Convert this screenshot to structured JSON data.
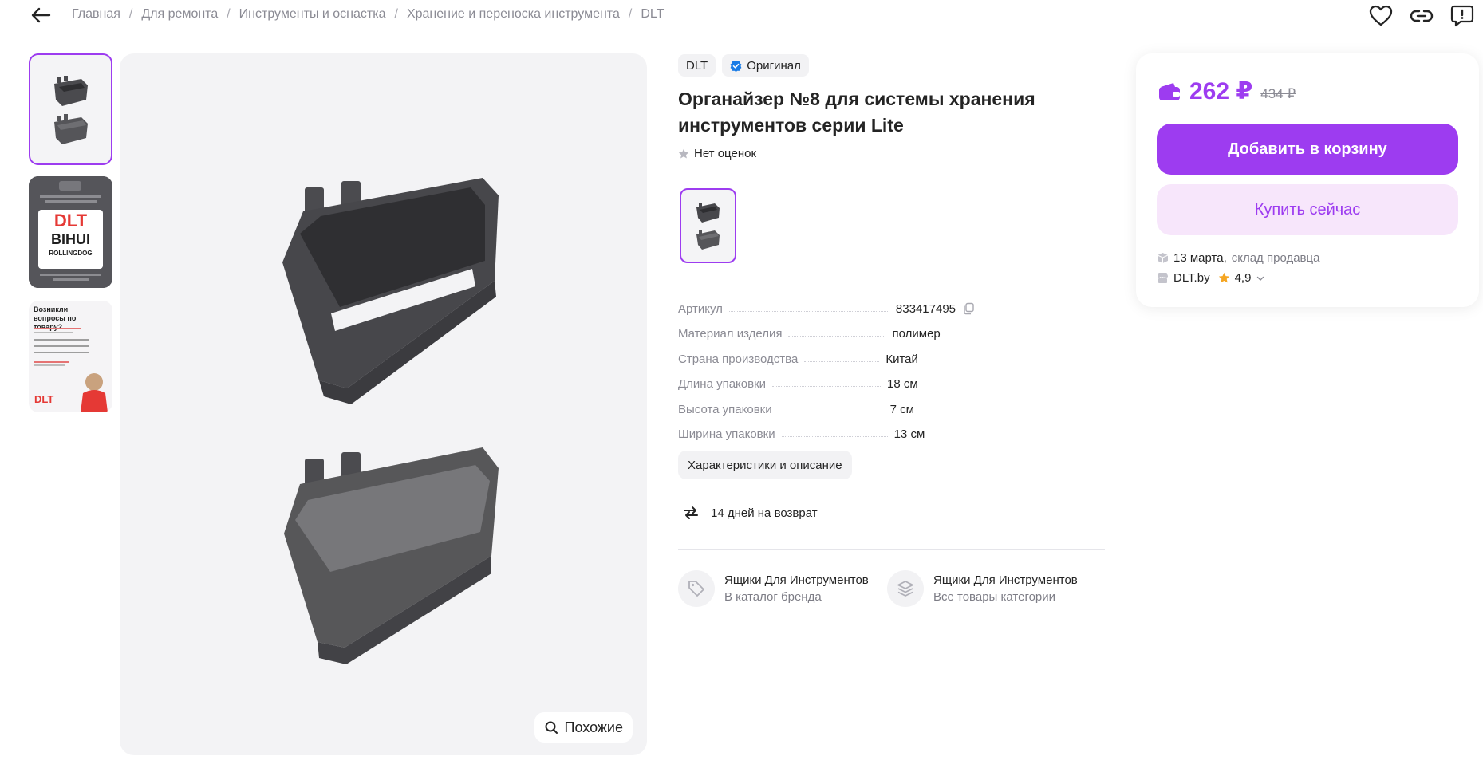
{
  "breadcrumb": {
    "items": [
      "Главная",
      "Для ремонта",
      "Инструменты и оснастка",
      "Хранение и переноска инструмента",
      "DLT"
    ],
    "separator": "/"
  },
  "top_actions": {
    "back_icon": "arrow-left-icon",
    "favorite_icon": "heart-icon",
    "share_icon": "link-icon",
    "report_icon": "report-icon"
  },
  "gallery": {
    "similar_label": "Похожие",
    "thumb2": {
      "line1": "DLT",
      "line2": "BIHUI",
      "line3": "ROLLINGDOG"
    },
    "thumb3": {
      "heading": "Возникли вопросы по товару?",
      "brand": "DLT"
    }
  },
  "product": {
    "brand_chip": "DLT",
    "original_chip": "Оригинал",
    "title": "Органайзер №8 для системы хранения инструментов серии Lite",
    "rating_text": "Нет оценок",
    "specs": [
      {
        "key": "Артикул",
        "value": "833417495"
      },
      {
        "key": "Материал изделия",
        "value": "полимер"
      },
      {
        "key": "Страна производства",
        "value": "Китай"
      },
      {
        "key": "Длина упаковки",
        "value": "18 см"
      },
      {
        "key": "Высота упаковки",
        "value": "7 см"
      },
      {
        "key": "Ширина упаковки",
        "value": "13 см"
      }
    ],
    "description_button": "Характеристики и описание",
    "return_text": "14 дней на возврат",
    "catalog_links": [
      {
        "title": "Ящики Для Инструментов",
        "subtitle": "В каталог бренда",
        "icon": "tag-icon"
      },
      {
        "title": "Ящики Для Инструментов",
        "subtitle": "Все товары категории",
        "icon": "layers-icon"
      }
    ]
  },
  "buy_box": {
    "price": "262 ₽",
    "old_price": "434 ₽",
    "add_to_cart": "Добавить в корзину",
    "buy_now": "Купить сейчас",
    "delivery_date": "13 марта,",
    "delivery_source": "склад продавца",
    "seller_name": "DLT.by",
    "seller_rating": "4,9"
  },
  "colors": {
    "accent": "#9d3cf0",
    "accent_light": "#f7e6fb",
    "text": "#242424",
    "muted": "#8b8b94",
    "star": "#f5a623",
    "verified": "#1a7ce6"
  }
}
